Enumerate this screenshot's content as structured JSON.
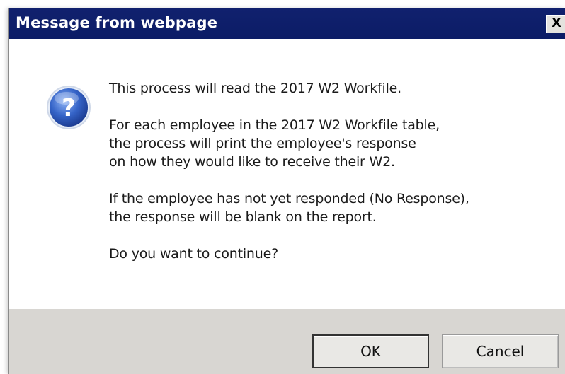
{
  "window": {
    "title": "Message from webpage",
    "close_label": "X"
  },
  "icon": {
    "name": "question-icon",
    "glyph": "?",
    "color": "#2a57b8"
  },
  "message": {
    "line1": "This process will read the 2017 W2 Workfile.",
    "paragraph2": "For each employee in the 2017 W2 Workfile table,\nthe process will print the employee's response\non how they would like to receive their W2.",
    "paragraph3": "If the employee has not yet responded (No Response),\nthe response will be blank on the report.",
    "question": "Do you want to continue?"
  },
  "buttons": {
    "ok": "OK",
    "cancel": "Cancel"
  },
  "colors": {
    "titlebar": "#0b1c66",
    "footer": "#d8d6d2"
  }
}
